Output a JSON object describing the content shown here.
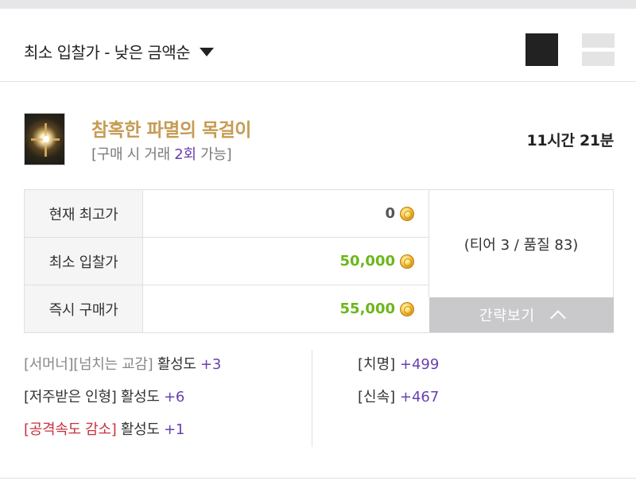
{
  "sort": {
    "label": "최소 입찰가 - 낮은 금액순"
  },
  "item": {
    "name": "참혹한 파멸의 목걸이",
    "trade_prefix": "[구매 시 거래 ",
    "trade_count": "2회",
    "trade_suffix": " 가능]",
    "time_left": "11시간 21분"
  },
  "prices": [
    {
      "label": "현재 최고가",
      "value": "0",
      "color": "#555555"
    },
    {
      "label": "최소 입찰가",
      "value": "50,000",
      "color": "#6cb71c"
    },
    {
      "label": "즉시 구매가",
      "value": "55,000",
      "color": "#6cb71c"
    }
  ],
  "tier_quality": "(티어 3 / 품질 83)",
  "brief_button": "간략보기",
  "engravings": [
    {
      "name": "[서머너][넘치는 교감]",
      "style": "gray",
      "label": " 활성도 ",
      "bonus": "+3"
    },
    {
      "name": "[저주받은 인형]",
      "style": "dark",
      "label": " 활성도 ",
      "bonus": "+6"
    },
    {
      "name": "[공격속도 감소]",
      "style": "red",
      "label": " 활성도 ",
      "bonus": "+1"
    }
  ],
  "stats": [
    {
      "name": "[치명] ",
      "value": "+499"
    },
    {
      "name": "[신속] ",
      "value": "+467"
    }
  ],
  "colors": {
    "item_name": "#c69c55",
    "accent_purple": "#6a3fb0",
    "price_green": "#6cb71c",
    "negative_red": "#c8313e"
  },
  "icons": {
    "sort": "caret-down-icon",
    "grid_view": "grid-view-icon",
    "list_view": "list-view-icon",
    "coin": "gold-coin-icon",
    "collapse": "chevron-up-icon"
  }
}
